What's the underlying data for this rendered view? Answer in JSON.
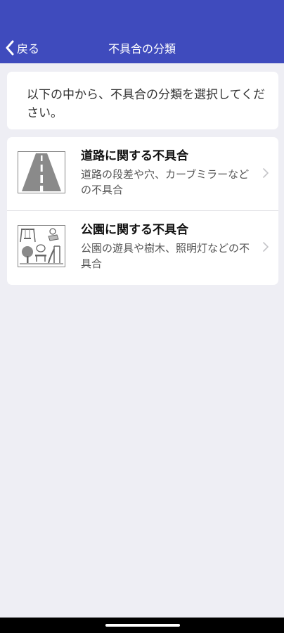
{
  "nav": {
    "back_label": "戻る",
    "title": "不具合の分類"
  },
  "instruction": {
    "text": "以下の中から、不具合の分類を選択してください。"
  },
  "categories": [
    {
      "title": "道路に関する不具合",
      "description": "道路の段差や穴、カーブミラーなどの不具合",
      "icon": "road-icon"
    },
    {
      "title": "公園に関する不具合",
      "description": "公園の遊具や樹木、照明灯などの不具合",
      "icon": "park-icon"
    }
  ],
  "colors": {
    "header": "#3f4bbd",
    "background": "#eeeef4",
    "card": "#ffffff"
  }
}
